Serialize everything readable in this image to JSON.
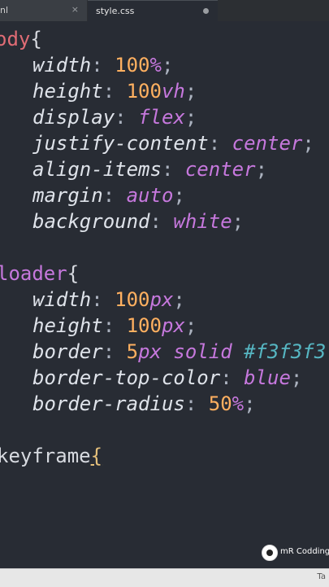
{
  "tabs": [
    {
      "label": "nl",
      "close": "×"
    },
    {
      "label": "style.css",
      "modified": true
    }
  ],
  "code": {
    "l1": {
      "sel": "ody",
      "brace": "{"
    },
    "l2": {
      "prop": "width",
      "num": "100",
      "unit": "%"
    },
    "l3": {
      "prop": "height",
      "num": "100",
      "unit": "vh"
    },
    "l4": {
      "prop": "display",
      "val": "flex"
    },
    "l5": {
      "prop": "justify-content",
      "val": "center"
    },
    "l6": {
      "prop": "align-items",
      "val": "center"
    },
    "l7": {
      "prop": "margin",
      "val": "auto"
    },
    "l8": {
      "prop": "background",
      "val": "white"
    },
    "l10": {
      "sel": "loader",
      "brace": "{"
    },
    "l11": {
      "prop": "width",
      "num": "100",
      "unit": "px"
    },
    "l12": {
      "prop": "height",
      "num": "100",
      "unit": "px"
    },
    "l13": {
      "prop": "border",
      "num": "5",
      "unit": "px",
      "kw": "solid",
      "hash": "#f3f3f3"
    },
    "l14": {
      "prop": "border-top-color",
      "val": "blue"
    },
    "l15": {
      "prop": "border-radius",
      "num": "50",
      "unit": "%"
    },
    "l17": {
      "at": "keyframe",
      "brace": "{"
    }
  },
  "statusbar": {
    "right": "Ta"
  },
  "watermark": {
    "text": "mR Codding"
  }
}
